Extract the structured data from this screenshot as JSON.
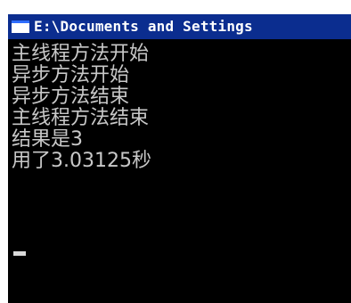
{
  "window": {
    "title": "E:\\Documents and Settings"
  },
  "console": {
    "lines": [
      "主线程方法开始",
      "异步方法开始",
      "异步方法结束",
      "主线程方法结束",
      "结果是3",
      "用了3.03125秒"
    ]
  },
  "colors": {
    "titlebar": "#0b2d8f",
    "console_bg": "#000000",
    "console_text": "#c8c8c8"
  }
}
